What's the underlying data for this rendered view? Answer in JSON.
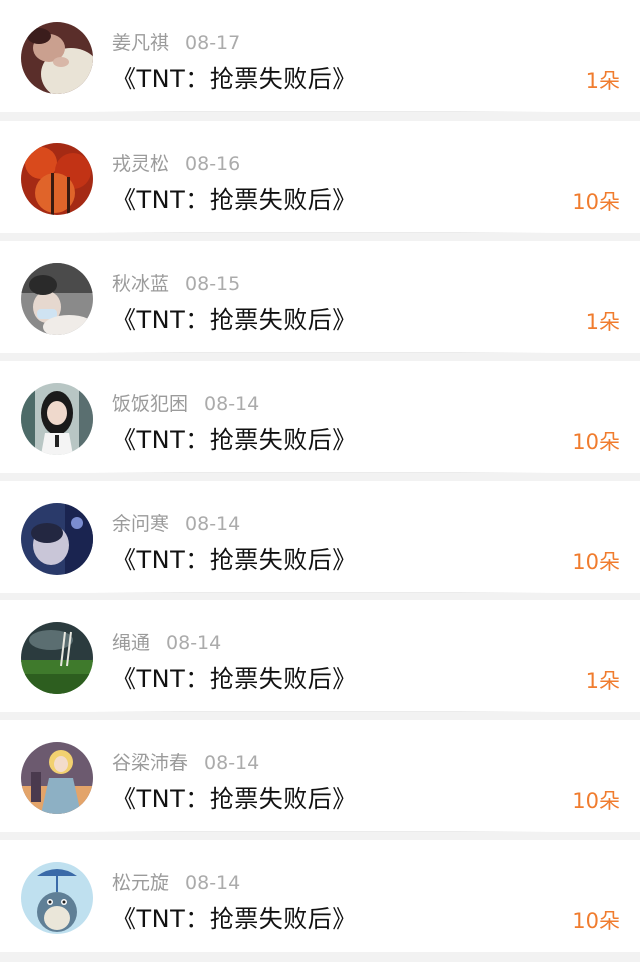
{
  "items": [
    {
      "name": "姜凡祺",
      "date": "08-17",
      "title": "《TNT：抢票失败后》",
      "gift": "1朵"
    },
    {
      "name": "戎灵松",
      "date": "08-16",
      "title": "《TNT：抢票失败后》",
      "gift": "10朵"
    },
    {
      "name": "秋冰蓝",
      "date": "08-15",
      "title": "《TNT：抢票失败后》",
      "gift": "1朵"
    },
    {
      "name": "饭饭犯困",
      "date": "08-14",
      "title": "《TNT：抢票失败后》",
      "gift": "10朵"
    },
    {
      "name": "余问寒",
      "date": "08-14",
      "title": "《TNT：抢票失败后》",
      "gift": "10朵"
    },
    {
      "name": "绳通",
      "date": "08-14",
      "title": "《TNT：抢票失败后》",
      "gift": "1朵"
    },
    {
      "name": "谷梁沛春",
      "date": "08-14",
      "title": "《TNT：抢票失败后》",
      "gift": "10朵"
    },
    {
      "name": "松元旋",
      "date": "08-14",
      "title": "《TNT：抢票失败后》",
      "gift": "10朵"
    }
  ],
  "colors": {
    "accent": "#f07c2e",
    "name_text": "#9b9b9b",
    "title_text": "#111111",
    "background": "#f2f2f2"
  }
}
